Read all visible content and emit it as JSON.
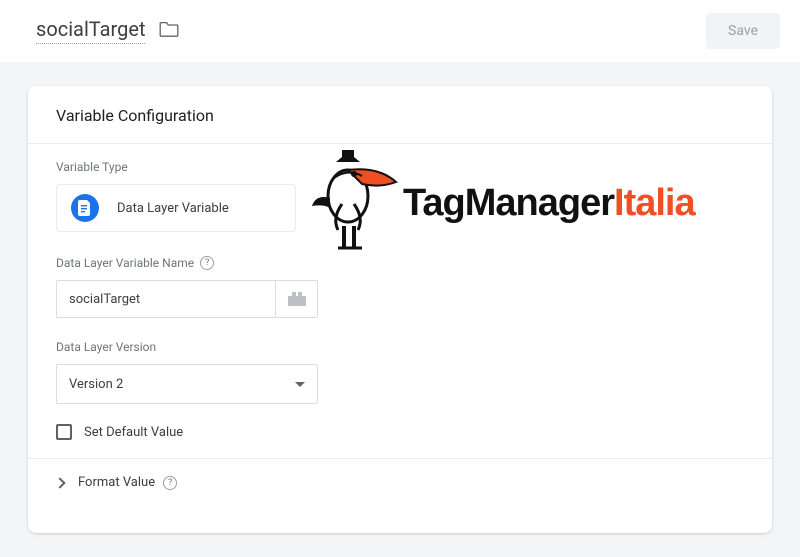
{
  "header": {
    "variable_name": "socialTarget",
    "save_label": "Save"
  },
  "card": {
    "title": "Variable Configuration",
    "variable_type_label": "Variable Type",
    "variable_type_value": "Data Layer Variable",
    "dlv_name_label": "Data Layer Variable Name",
    "dlv_name_value": "socialTarget",
    "dlv_version_label": "Data Layer Version",
    "dlv_version_value": "Version 2",
    "set_default_label": "Set Default Value",
    "format_value_label": "Format Value"
  },
  "logo": {
    "text1": "TagManager",
    "text2": "Italia"
  }
}
